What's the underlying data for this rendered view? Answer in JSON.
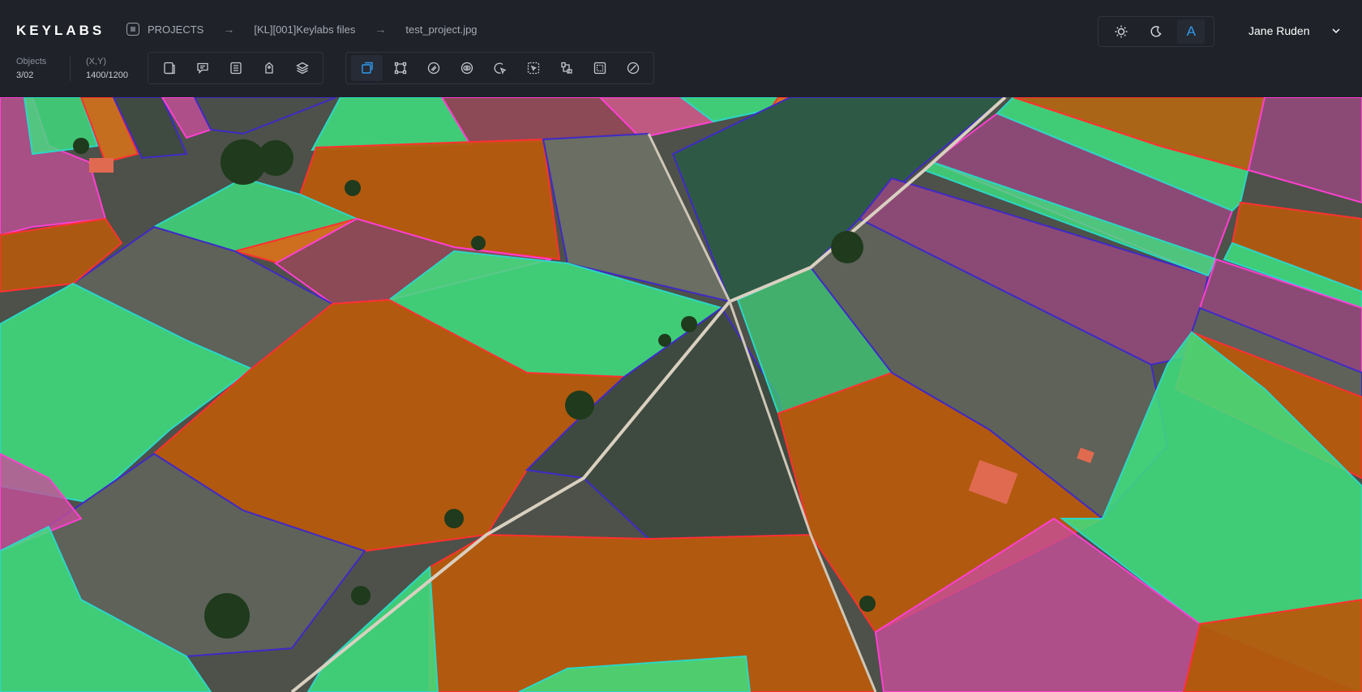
{
  "app": {
    "logo": "KEYLABS",
    "breadcrumbs": [
      "PROJECTS",
      "[KL][001]Keylabs files",
      "test_project.jpg"
    ]
  },
  "theme_switcher": {
    "options": [
      "sun-icon",
      "moon-icon",
      "auto-icon"
    ],
    "auto_label": "A",
    "active": "auto"
  },
  "user": {
    "name": "Jane Ruden"
  },
  "stats": {
    "objects_label": "Objects",
    "objects_value": "3/02",
    "coords_label": "(X,Y)",
    "coords_value": "1400/1200"
  },
  "toolbar": {
    "group1": [
      "file-icon",
      "comment-icon",
      "list-icon",
      "tag-icon",
      "layers-icon"
    ],
    "group2": [
      "box-select-icon",
      "polygon-icon",
      "brush-icon",
      "eye-icon",
      "cursor-select-icon",
      "magic-select-icon",
      "crop-icon",
      "grid-select-icon",
      "eraser-icon"
    ],
    "active_tool": "box-select-icon"
  },
  "colors": {
    "accent": "#2f9bf0",
    "background": "#1f2229",
    "mask_green": "#3ee27f",
    "mask_orange": "#b65a0c",
    "mask_pink": "#c74f9a",
    "mask_teal": "#2cd6c6",
    "mask_purple": "#3f2ac7",
    "mask_red": "#ff3030"
  }
}
